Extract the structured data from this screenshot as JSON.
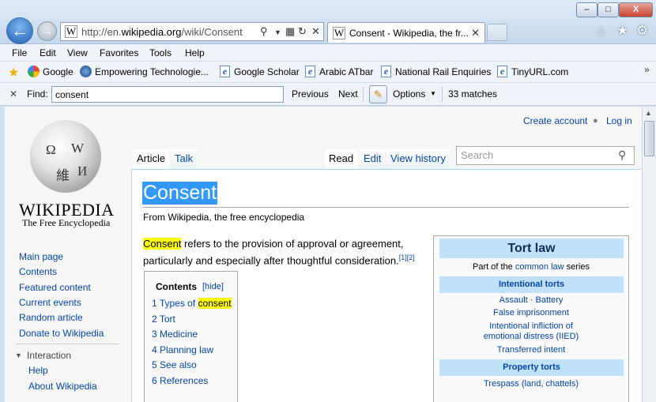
{
  "browser": {
    "window_controls": {
      "minimize": "–",
      "maximize": "□",
      "close": "X"
    },
    "address": {
      "scheme": "http://en.",
      "domain": "wikipedia.org",
      "path": "/wiki/Consent"
    },
    "tab_title": "Consent - Wikipedia, the fr...",
    "favicon": "W",
    "icons": [
      "back-arrow-icon",
      "forward-arrow-icon",
      "search-icon",
      "dropdown-icon",
      "compatibility-icon",
      "refresh-icon",
      "stop-icon",
      "home-icon",
      "favorites-star-icon",
      "tools-gear-icon"
    ]
  },
  "menu": [
    "File",
    "Edit",
    "View",
    "Favorites",
    "Tools",
    "Help"
  ],
  "favorites": [
    "Google",
    "Empowering Technologie...",
    "Google Scholar",
    "Arabic ATbar",
    "National Rail Enquiries",
    "TinyURL.com"
  ],
  "find_bar": {
    "label": "Find:",
    "query": "consent",
    "previous": "Previous",
    "next": "Next",
    "options": "Options",
    "matches": "33 matches"
  },
  "page": {
    "logo": {
      "wordmark": "WIKIPEDIA",
      "tagline": "The Free Encyclopedia",
      "glyphs": [
        "Ω",
        "W",
        "維",
        "И"
      ]
    },
    "account": {
      "create": "Create account",
      "login": "Log in"
    },
    "sidebar": {
      "links": [
        "Main page",
        "Contents",
        "Featured content",
        "Current events",
        "Random article",
        "Donate to Wikipedia"
      ],
      "section": "Interaction",
      "section_links": [
        "Help",
        "About Wikipedia"
      ]
    },
    "tabs": {
      "article": "Article",
      "talk": "Talk",
      "read": "Read",
      "edit": "Edit",
      "history": "View history"
    },
    "search_placeholder": "Search",
    "title": "Consent",
    "subtitle": "From Wikipedia, the free encyclopedia",
    "lead": {
      "hl": "Consent",
      "rest1": " refers to the provision of approval or agreement,",
      "rest2": "particularly and especially after thoughtful consideration.",
      "refs": "[1][2]"
    },
    "toc": {
      "title": "Contents",
      "hide": "[hide]",
      "items": [
        {
          "num": "1",
          "pre": "Types of ",
          "hl": "consent"
        },
        {
          "num": "2",
          "pre": "Tort",
          "hl": ""
        },
        {
          "num": "3",
          "pre": "Medicine",
          "hl": ""
        },
        {
          "num": "4",
          "pre": "Planning law",
          "hl": ""
        },
        {
          "num": "5",
          "pre": "See also",
          "hl": ""
        },
        {
          "num": "6",
          "pre": "References",
          "hl": ""
        }
      ]
    },
    "infobox": {
      "title": "Tort law",
      "part_of": "Part of the ",
      "part_link": "common law",
      "part_suffix": " series",
      "section1": "Intentional torts",
      "s1_line1": "Assault · Battery",
      "s1_line2": "False imprisonment",
      "s1_line3": "Intentional infliction of",
      "s1_line4": "emotional distress (IIED)",
      "s1_line5": "Transferred intent",
      "section2": "Property torts",
      "s2_line1": "Trespass (land, chattels)"
    }
  }
}
